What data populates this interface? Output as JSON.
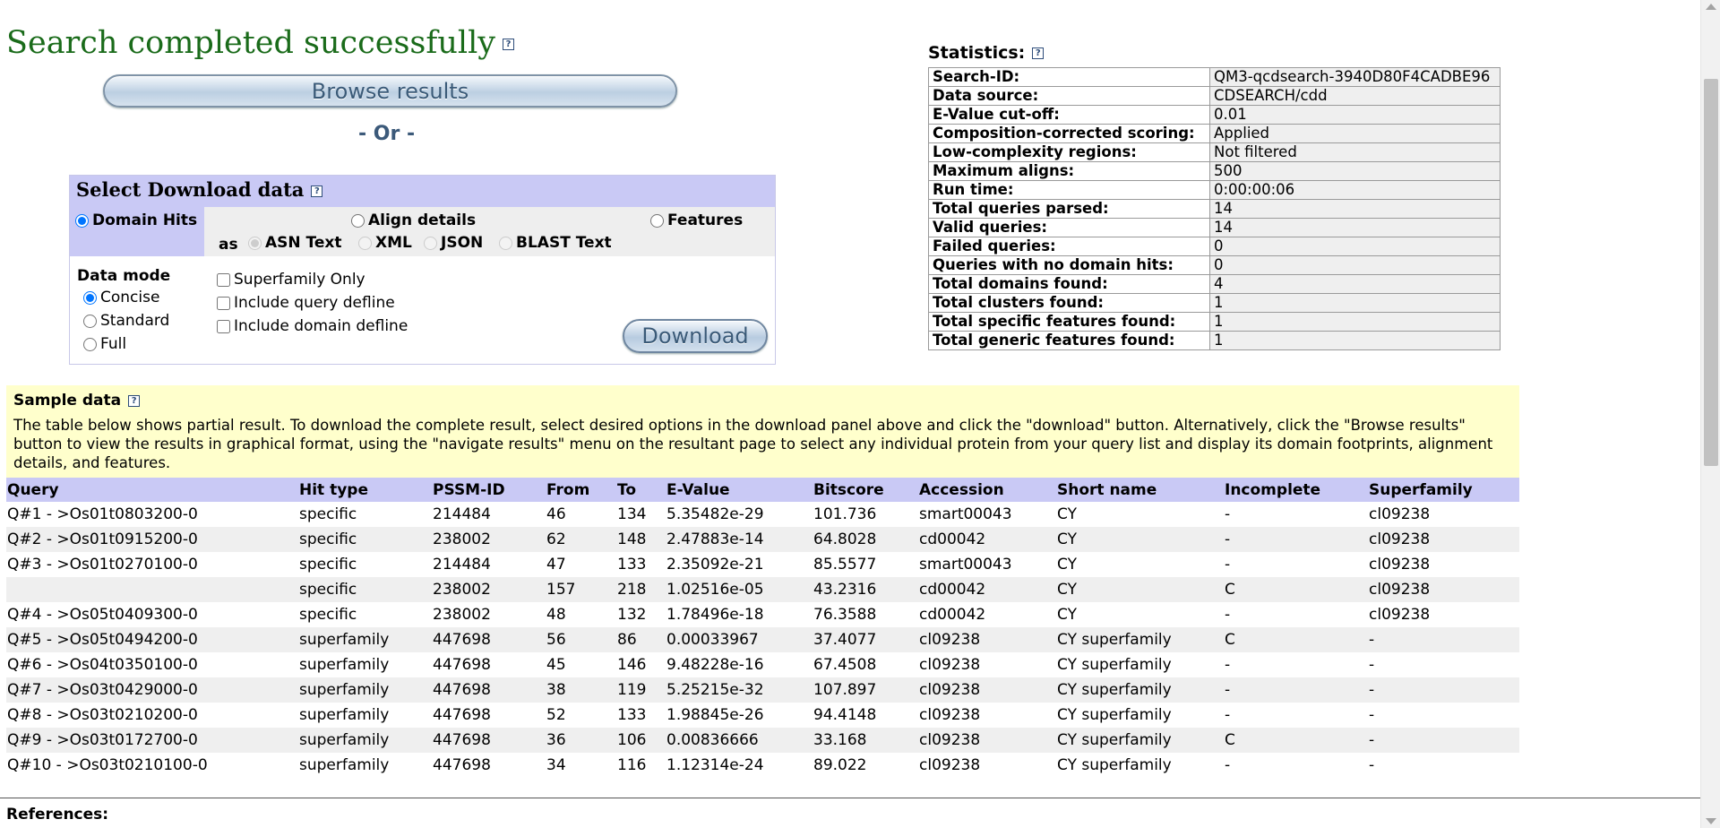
{
  "header": {
    "title": "Search completed successfully",
    "help": "?"
  },
  "browse": {
    "label": "Browse results",
    "or_text": "- Or -"
  },
  "download_panel": {
    "title": "Select Download data",
    "help": "?",
    "types": [
      "Domain Hits",
      "Align details",
      "Features"
    ],
    "selected_type": "Domain Hits",
    "as_label": "as",
    "formats": [
      "ASN Text",
      "XML",
      "JSON",
      "BLAST Text"
    ],
    "data_mode_label": "Data mode",
    "modes": [
      "Concise",
      "Standard",
      "Full"
    ],
    "selected_mode": "Concise",
    "options": [
      "Superfamily Only",
      "Include query defline",
      "Include domain defline"
    ],
    "download_label": "Download"
  },
  "statistics": {
    "title": "Statistics:",
    "help": "?",
    "rows": [
      {
        "key": "Search-ID:",
        "value": "QM3-qcdsearch-3940D80F4CADBE96"
      },
      {
        "key": "Data source:",
        "value": "CDSEARCH/cdd"
      },
      {
        "key": "E-Value cut-off:",
        "value": "0.01"
      },
      {
        "key": "Composition-corrected scoring:",
        "value": "Applied"
      },
      {
        "key": "Low-complexity regions:",
        "value": "Not filtered"
      },
      {
        "key": "Maximum aligns:",
        "value": "500"
      },
      {
        "key": "Run time:",
        "value": "0:00:00:06"
      },
      {
        "key": "Total queries parsed:",
        "value": "14"
      },
      {
        "key": "Valid queries:",
        "value": "14"
      },
      {
        "key": "Failed queries:",
        "value": "0"
      },
      {
        "key": "Queries with no domain hits:",
        "value": "0"
      },
      {
        "key": "Total domains found:",
        "value": "4"
      },
      {
        "key": "Total clusters found:",
        "value": "1"
      },
      {
        "key": "Total specific features found:",
        "value": "1"
      },
      {
        "key": "Total generic features found:",
        "value": "1"
      }
    ]
  },
  "sample": {
    "title": "Sample data",
    "help": "?",
    "description": "The table below shows partial result. To download the complete result, select desired options in the download panel above and click the \"download\" button. Alternatively, click the \"Browse results\" button to view the results in graphical format, using the \"navigate results\" menu on the resultant page to select any individual protein from your query list and display its domain footprints, alignment details, and features."
  },
  "results": {
    "columns": [
      "Query",
      "Hit type",
      "PSSM-ID",
      "From",
      "To",
      "E-Value",
      "Bitscore",
      "Accession",
      "Short name",
      "Incomplete",
      "Superfamily"
    ],
    "rows": [
      [
        "Q#1 - >Os01t0803200-0",
        "specific",
        "214484",
        "46",
        "134",
        "5.35482e-29",
        "101.736",
        "smart00043",
        "CY",
        "-",
        "cl09238"
      ],
      [
        "Q#2 - >Os01t0915200-0",
        "specific",
        "238002",
        "62",
        "148",
        "2.47883e-14",
        "64.8028",
        "cd00042",
        "CY",
        "-",
        "cl09238"
      ],
      [
        "Q#3 - >Os01t0270100-0",
        "specific",
        "214484",
        "47",
        "133",
        "2.35092e-21",
        "85.5577",
        "smart00043",
        "CY",
        "-",
        "cl09238"
      ],
      [
        "",
        "specific",
        "238002",
        "157",
        "218",
        "1.02516e-05",
        "43.2316",
        "cd00042",
        "CY",
        "C",
        "cl09238"
      ],
      [
        "Q#4 - >Os05t0409300-0",
        "specific",
        "238002",
        "48",
        "132",
        "1.78496e-18",
        "76.3588",
        "cd00042",
        "CY",
        "-",
        "cl09238"
      ],
      [
        "Q#5 - >Os05t0494200-0",
        "superfamily",
        "447698",
        "56",
        "86",
        "0.00033967",
        "37.4077",
        "cl09238",
        "CY superfamily",
        "C",
        "-"
      ],
      [
        "Q#6 - >Os04t0350100-0",
        "superfamily",
        "447698",
        "45",
        "146",
        "9.48228e-16",
        "67.4508",
        "cl09238",
        "CY superfamily",
        "-",
        "-"
      ],
      [
        "Q#7 - >Os03t0429000-0",
        "superfamily",
        "447698",
        "38",
        "119",
        "5.25215e-32",
        "107.897",
        "cl09238",
        "CY superfamily",
        "-",
        "-"
      ],
      [
        "Q#8 - >Os03t0210200-0",
        "superfamily",
        "447698",
        "52",
        "133",
        "1.98845e-26",
        "94.4148",
        "cl09238",
        "CY superfamily",
        "-",
        "-"
      ],
      [
        "Q#9 - >Os03t0172700-0",
        "superfamily",
        "447698",
        "36",
        "106",
        "0.00836666",
        "33.168",
        "cl09238",
        "CY superfamily",
        "C",
        "-"
      ],
      [
        "Q#10 - >Os03t0210100-0",
        "superfamily",
        "447698",
        "34",
        "116",
        "1.12314e-24",
        "89.022",
        "cl09238",
        "CY superfamily",
        "-",
        "-"
      ]
    ]
  },
  "references": {
    "title": "References:"
  }
}
